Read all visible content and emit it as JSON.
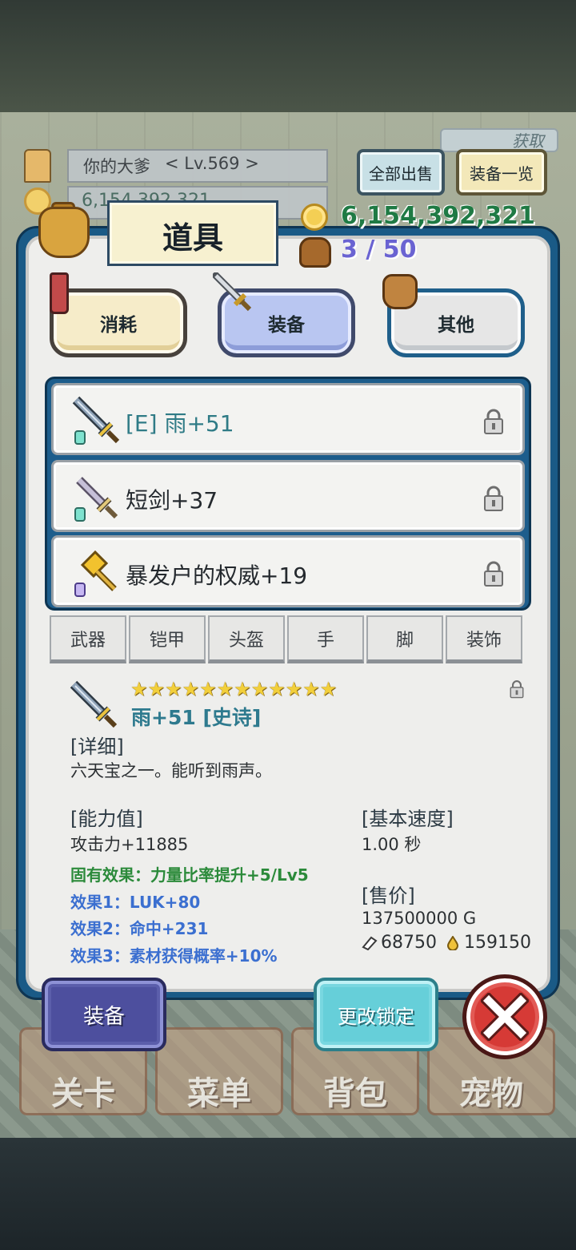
{
  "player": {
    "name": "你的大爹",
    "level": "< Lv.569 >",
    "gold_partial": "6,154,392,321"
  },
  "header_buttons": {
    "acquire": "获取",
    "sell_all": "全部出售",
    "equip_list": "装备一览"
  },
  "panel": {
    "title": "道具",
    "gold": "6,154,392,321",
    "capacity": "3 / 50"
  },
  "category_tabs": {
    "consume": "消耗",
    "equip": "装备",
    "other": "其他",
    "selected": "装备"
  },
  "items": [
    {
      "name": "[E] 雨+51",
      "equipped": true,
      "icon": "sword-icon",
      "gem": "teal-gem-icon"
    },
    {
      "name": "短剑+37",
      "equipped": false,
      "icon": "short-sword-icon",
      "gem": "teal-gem-icon"
    },
    {
      "name": "暴发户的权威+19",
      "equipped": false,
      "icon": "golden-hammer-icon",
      "gem": "purple-gem-icon"
    }
  ],
  "slot_tabs": [
    "武器",
    "铠甲",
    "头盔",
    "手",
    "脚",
    "装饰"
  ],
  "detail": {
    "stars": "★★★★★★★★★★★★",
    "star_count": 12,
    "name": "雨+51 [史诗]",
    "detail_header": "[详细]",
    "description": "六天宝之一。能听到雨声。",
    "stats_header": "[能力值]",
    "attack": "攻击力+11885",
    "inherent": "固有效果：力量比率提升+5/Lv5",
    "effect1": "效果1：LUK+80",
    "effect2": "效果2：命中+231",
    "effect3": "效果3：素材获得概率+10%",
    "speed_header": "[基本速度]",
    "speed": "1.00 秒",
    "price_header": "[售价]",
    "price": "137500000 G",
    "stone_value": "68750",
    "drop_value": "159150"
  },
  "actions": {
    "equip": "装备",
    "change_lock": "更改锁定",
    "close": "close"
  },
  "bottom_nav": [
    "关卡",
    "菜单",
    "背包",
    "宠物"
  ],
  "colors": {
    "panel_border": "#1a5a86",
    "gold_text": "#1f7a44",
    "capacity_text": "#6a63d2",
    "equipped_text": "#2f7b86",
    "close_red": "#d63a36"
  }
}
